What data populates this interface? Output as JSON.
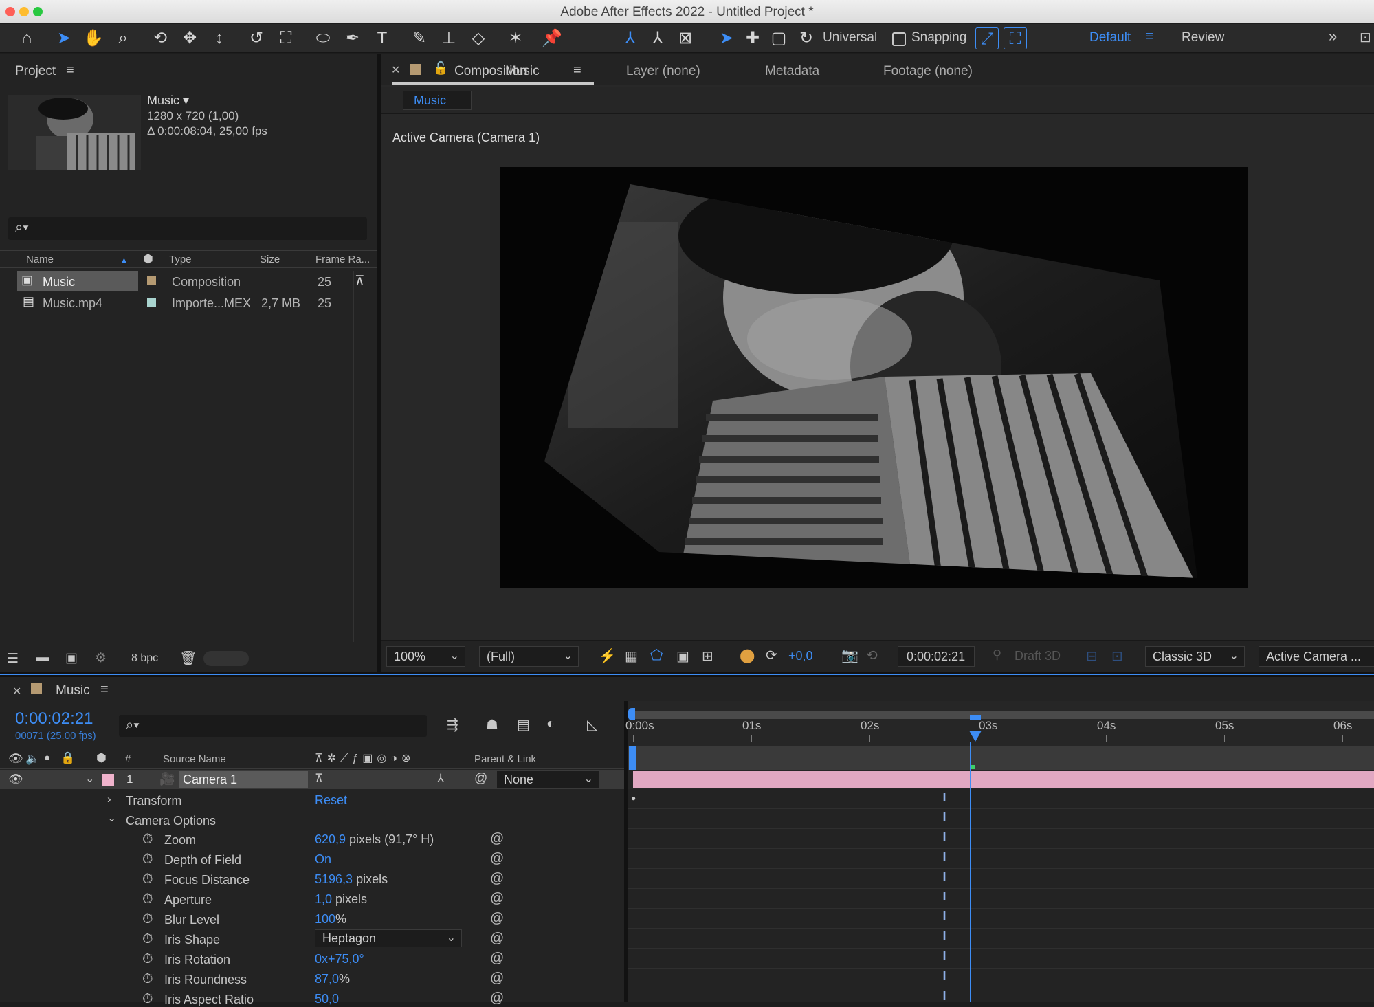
{
  "window": {
    "title": "Adobe After Effects 2022 - Untitled Project *"
  },
  "toolbar": {
    "universal_label": "Universal",
    "snapping_label": "Snapping",
    "workspace_default": "Default",
    "workspace_review": "Review"
  },
  "project": {
    "panel_title": "Project",
    "item_name": "Music ▾",
    "item_resolution": "1280 x 720 (1,00)",
    "item_duration": "Δ 0:00:08:04, 25,00 fps",
    "search_placeholder": "",
    "columns": {
      "name": "Name",
      "type": "Type",
      "size": "Size",
      "frame_rate": "Frame Ra..."
    },
    "rows": [
      {
        "name": "Music",
        "type": "Composition",
        "size": "",
        "frame_rate": "25",
        "label_color": "#b59a72"
      },
      {
        "name": "Music.mp4",
        "type": "Importe...MEX",
        "size": "2,7 MB",
        "frame_rate": "25",
        "label_color": "#a9d4cf"
      }
    ],
    "bpc": "8 bpc"
  },
  "viewer": {
    "tab_composition_prefix": "Composition",
    "tab_composition_name": "Music",
    "tab_layer": "Layer (none)",
    "tab_metadata": "Metadata",
    "tab_footage": "Footage (none)",
    "sub_tab": "Music",
    "camera_label": "Active Camera (Camera 1)",
    "zoom": "100%",
    "resolution": "(Full)",
    "exposure": "+0,0",
    "timecode": "0:00:02:21",
    "draft3d": "Draft 3D",
    "renderer": "Classic 3D",
    "view": "Active Camera ..."
  },
  "timeline": {
    "panel_title": "Music",
    "timecode": "0:00:02:21",
    "frame_info": "00071 (25.00 fps)",
    "columns": {
      "number": "#",
      "source_name": "Source Name",
      "parent": "Parent & Link"
    },
    "layer": {
      "number": "1",
      "name": "Camera 1",
      "parent": "None"
    },
    "transform_label": "Transform",
    "transform_reset": "Reset",
    "camera_options_label": "Camera Options",
    "properties": [
      {
        "name": "Zoom",
        "value": "620,9",
        "unit": " pixels (91,7° H)"
      },
      {
        "name": "Depth of Field",
        "value": "On",
        "unit": ""
      },
      {
        "name": "Focus Distance",
        "value": "5196,3",
        "unit": " pixels"
      },
      {
        "name": "Aperture",
        "value": "1,0",
        "unit": " pixels"
      },
      {
        "name": "Blur Level",
        "value": "100",
        "unit": "%"
      },
      {
        "name": "Iris Shape",
        "value": "Heptagon",
        "unit": ""
      },
      {
        "name": "Iris Rotation",
        "value": "0x+75,0°",
        "unit": ""
      },
      {
        "name": "Iris Roundness",
        "value": "87,0",
        "unit": "%"
      },
      {
        "name": "Iris Aspect Ratio",
        "value": "50,0",
        "unit": ""
      }
    ],
    "ruler": [
      "0:00s",
      "01s",
      "02s",
      "03s",
      "04s",
      "05s",
      "06s"
    ],
    "playhead_seconds": 2.84
  },
  "colors": {
    "accent": "#3d8df5",
    "layer_bar": "#e1a8c2",
    "camera_label": "#f0b3cc"
  }
}
